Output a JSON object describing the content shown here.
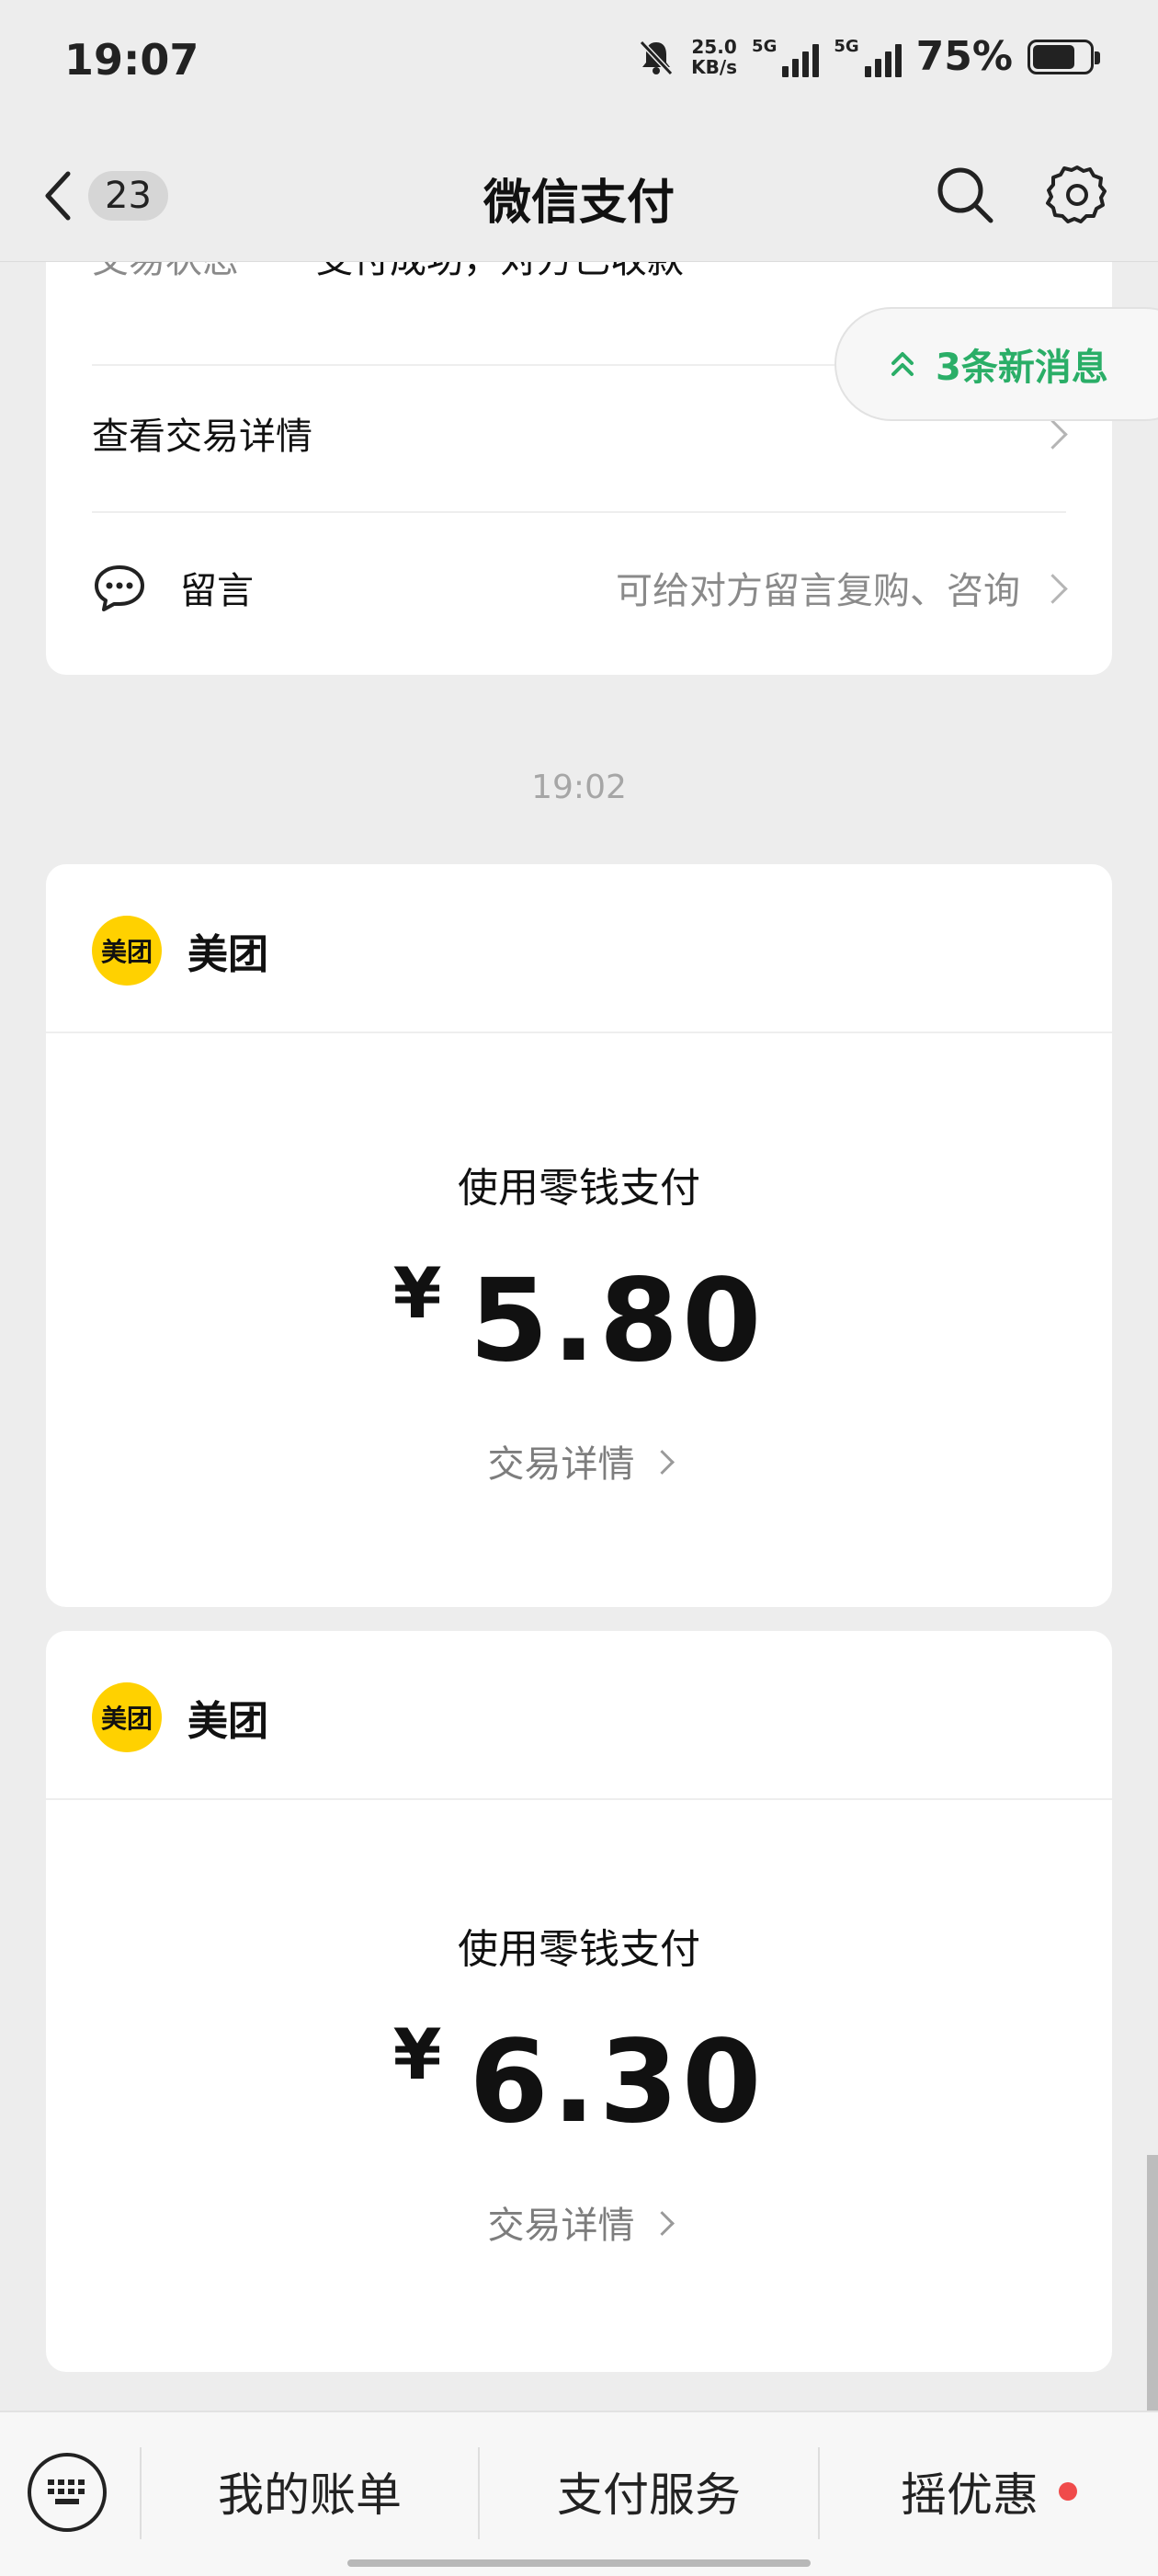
{
  "status_bar": {
    "time": "19:07",
    "net_speed_value": "25.0",
    "net_speed_unit": "KB/s",
    "sim1_label": "5G",
    "sim2_label": "5G",
    "battery_pct": "75%",
    "battery_level": 0.75
  },
  "nav": {
    "unread_count": "23",
    "title": "微信支付"
  },
  "top_card": {
    "status_label": "交易状态",
    "status_value": "支付成功，对方已收款",
    "view_details": "查看交易详情",
    "comment_label": "留言",
    "comment_hint": "可给对方留言复购、咨询"
  },
  "new_messages": "3条新消息",
  "timestamp": "19:02",
  "payments": [
    {
      "merchant": "美团",
      "logo_text": "美团",
      "method": "使用零钱支付",
      "currency": "¥",
      "amount": "5.80",
      "detail_link": "交易详情"
    },
    {
      "merchant": "美团",
      "logo_text": "美团",
      "method": "使用零钱支付",
      "currency": "¥",
      "amount": "6.30",
      "detail_link": "交易详情"
    }
  ],
  "bottom_bar": {
    "items": [
      "我的账单",
      "支付服务",
      "摇优惠"
    ]
  },
  "colors": {
    "accent_green": "#2aae67",
    "meituan_yellow": "#ffd100",
    "notify_red": "#f04b4b"
  },
  "icons": [
    "chevron-left-icon",
    "search-icon",
    "gear-icon",
    "comment-icon",
    "double-chevron-up-icon",
    "keyboard-icon",
    "chevron-right-icon",
    "mute-bell-icon",
    "signal-icon",
    "battery-icon"
  ]
}
